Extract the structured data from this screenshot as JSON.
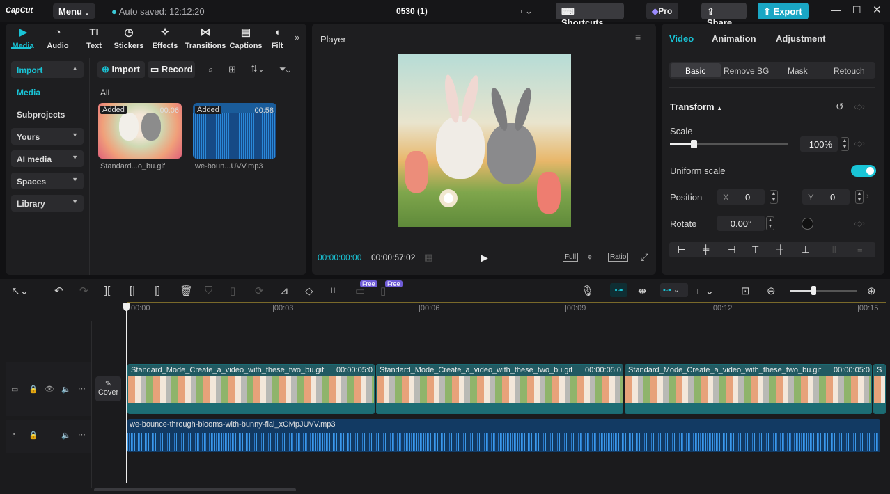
{
  "app": {
    "logo": "CapCut",
    "menu_label": "Menu",
    "autosave": "Auto saved: 12:12:20",
    "project_title": "0530 (1)",
    "shortcuts_label": "Shortcuts",
    "pro_label": "Pro",
    "share_label": "Share",
    "export_label": "Export"
  },
  "media_tabs": [
    {
      "label": "Media",
      "icon": "media-icon",
      "active": true
    },
    {
      "label": "Audio",
      "icon": "audio-icon"
    },
    {
      "label": "Text",
      "icon": "text-icon"
    },
    {
      "label": "Stickers",
      "icon": "sticker-icon"
    },
    {
      "label": "Effects",
      "icon": "effects-icon"
    },
    {
      "label": "Transitions",
      "icon": "transitions-icon"
    },
    {
      "label": "Captions",
      "icon": "captions-icon"
    },
    {
      "label": "Filt",
      "icon": "filters-icon"
    }
  ],
  "sidebar": {
    "import": "Import",
    "media": "Media",
    "subprojects": "Subprojects",
    "yours": "Yours",
    "ai_media": "AI media",
    "spaces": "Spaces",
    "library": "Library"
  },
  "media_toolbar": {
    "import": "Import",
    "record": "Record",
    "all": "All"
  },
  "media_items": [
    {
      "tag": "Added",
      "duration": "00:06",
      "name": "Standard...o_bu.gif"
    },
    {
      "tag": "Added",
      "duration": "00:58",
      "name": "we-boun...UVV.mp3"
    }
  ],
  "player": {
    "title": "Player",
    "current_time": "00:00:00:00",
    "total_time": "00:00:57:02",
    "full_label": "Full",
    "ratio_label": "Ratio"
  },
  "inspector": {
    "tabs": [
      "Video",
      "Animation",
      "Adjustment"
    ],
    "subtabs": [
      "Basic",
      "Remove BG",
      "Mask",
      "Retouch"
    ],
    "transform_label": "Transform",
    "scale_label": "Scale",
    "scale_value": "100%",
    "scale_fraction": 0.2,
    "uniform_label": "Uniform scale",
    "uniform_on": true,
    "position_label": "Position",
    "x_label": "X",
    "x_value": "0",
    "y_label": "Y",
    "y_value": "0",
    "rotate_label": "Rotate",
    "rotate_value": "0.00°"
  },
  "timeline": {
    "badge_free_1": "Free",
    "badge_free_2": "Free",
    "ruler": [
      "00:00",
      "|00:03",
      "|00:06",
      "|00:09",
      "|00:12",
      "|00:15"
    ],
    "cover_label": "Cover",
    "clips": [
      {
        "name": "Standard_Mode_Create_a_video_with_these_two_bu.gif",
        "time": "00:00:05:0"
      },
      {
        "name": "Standard_Mode_Create_a_video_with_these_two_bu.gif",
        "time": "00:00:05:0"
      },
      {
        "name": "Standard_Mode_Create_a_video_with_these_two_bu.gif",
        "time": "00:00:05:0"
      },
      {
        "name": "S",
        "time": ""
      }
    ],
    "audio_clip": "we-bounce-through-blooms-with-bunny-flai_xOMpJUVV.mp3"
  },
  "colors": {
    "accent": "#19c4d6",
    "export": "#1aa6c4",
    "panel": "#1e1e20"
  }
}
